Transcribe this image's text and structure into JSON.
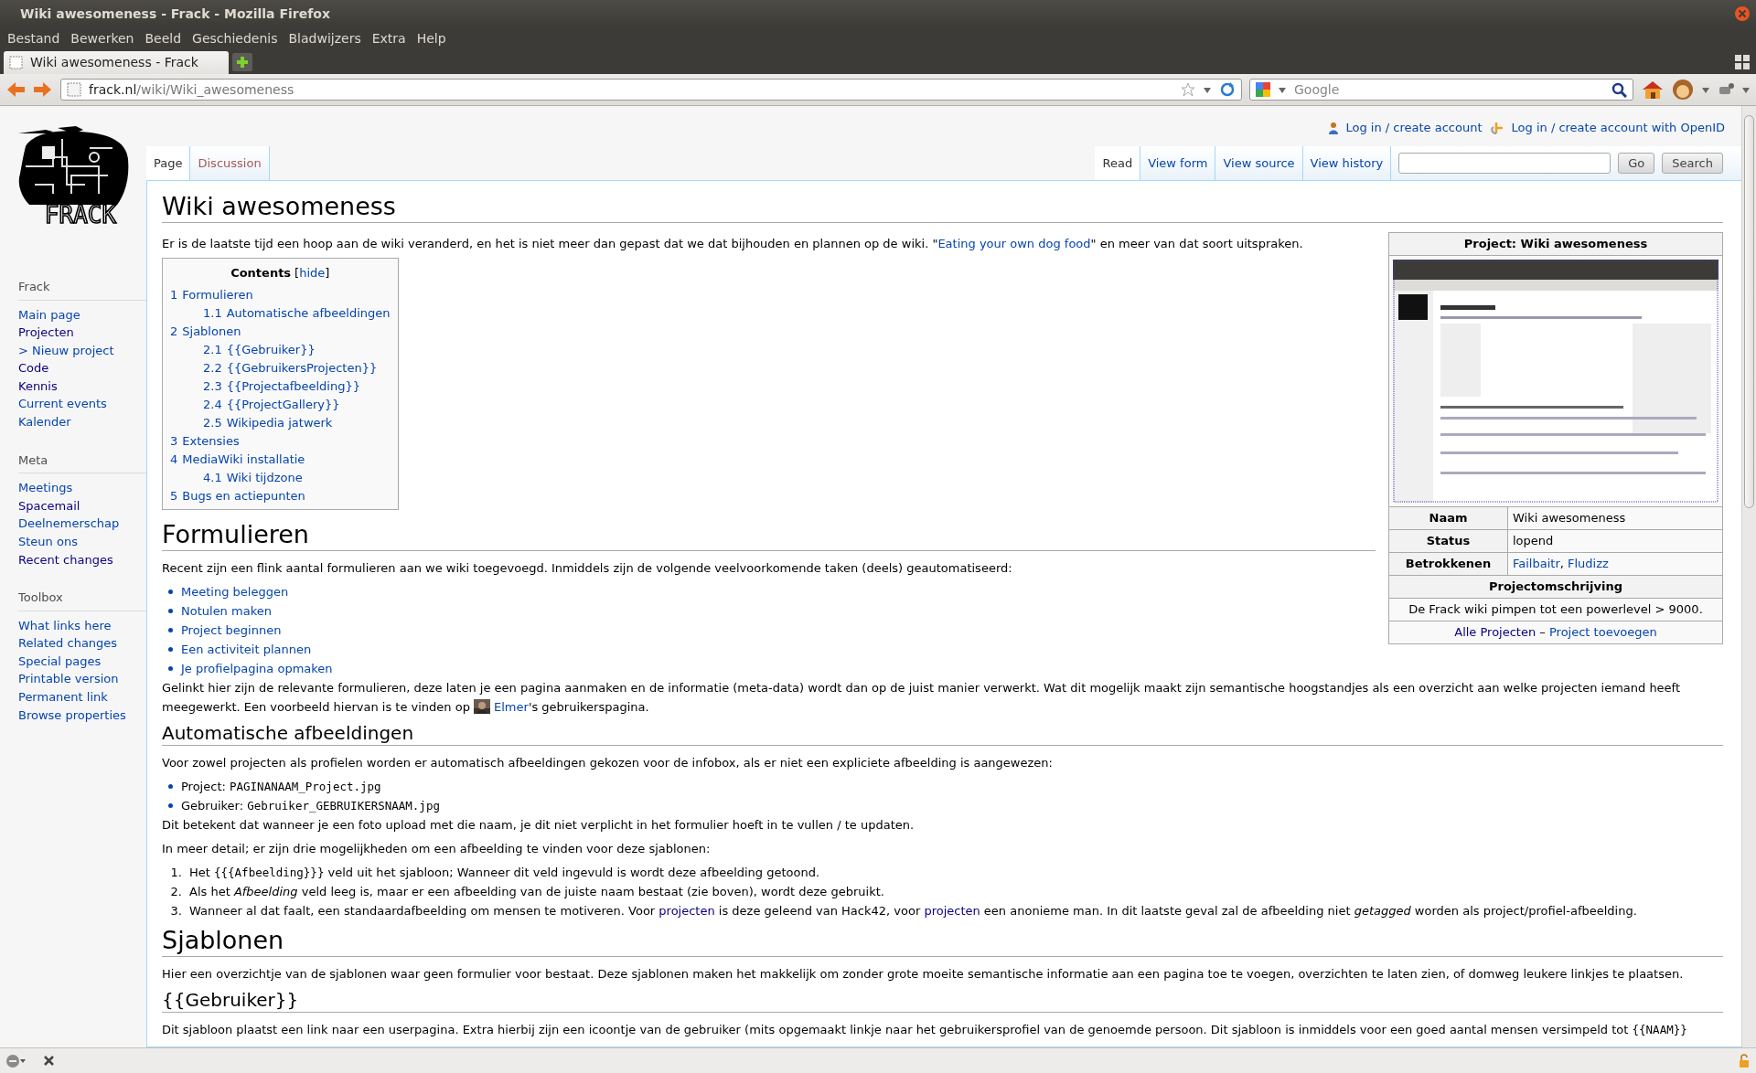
{
  "window": {
    "title": "Wiki awesomeness - Frack - Mozilla Firefox"
  },
  "menu": [
    "Bestand",
    "Bewerken",
    "Beeld",
    "Geschiedenis",
    "Bladwijzers",
    "Extra",
    "Help"
  ],
  "browser_tabs": [
    {
      "label": "Wiki awesomeness - Frack",
      "selected": true
    }
  ],
  "address_bar": {
    "domain": "frack.nl",
    "path": "/wiki/Wiki_awesomeness"
  },
  "web_search": {
    "placeholder": "Google"
  },
  "logo": {
    "text": "FRACK"
  },
  "personal_links": [
    "Log in / create account",
    "Log in / create account with OpenID"
  ],
  "page_tabs": [
    {
      "label": "Page",
      "selected": true,
      "exists": true
    },
    {
      "label": "Discussion",
      "selected": false,
      "exists": false
    }
  ],
  "view_tabs": [
    {
      "label": "Read",
      "selected": true
    },
    {
      "label": "View form",
      "selected": false
    },
    {
      "label": "View source",
      "selected": false
    },
    {
      "label": "View history",
      "selected": false
    }
  ],
  "wiki_search": {
    "buttons": [
      "Go",
      "Search"
    ]
  },
  "sidebar": [
    {
      "title": "Frack",
      "items": [
        {
          "label": "Main page",
          "visited": false
        },
        {
          "label": "Projecten",
          "visited": true
        },
        {
          "label": "> Nieuw project",
          "visited": false
        },
        {
          "label": "Code",
          "visited": true
        },
        {
          "label": "Kennis",
          "visited": true
        },
        {
          "label": "Current events",
          "visited": false
        },
        {
          "label": "Kalender",
          "visited": false
        }
      ]
    },
    {
      "title": "Meta",
      "items": [
        {
          "label": "Meetings",
          "visited": false
        },
        {
          "label": "Spacemail",
          "visited": true
        },
        {
          "label": "Deelnemerschap",
          "visited": false
        },
        {
          "label": "Steun ons",
          "visited": false
        },
        {
          "label": "Recent changes",
          "visited": true
        }
      ]
    },
    {
      "title": "Toolbox",
      "items": [
        {
          "label": "What links here",
          "visited": false
        },
        {
          "label": "Related changes",
          "visited": false
        },
        {
          "label": "Special pages",
          "visited": false
        },
        {
          "label": "Printable version",
          "visited": false
        },
        {
          "label": "Permanent link",
          "visited": false
        },
        {
          "label": "Browse properties",
          "visited": false
        }
      ]
    }
  ],
  "article": {
    "title": "Wiki awesomeness",
    "infobox": {
      "title": "Project: Wiki awesomeness",
      "image": {
        "kind": "picture"
      },
      "rows": [
        {
          "label": "Naam",
          "value": [
            {
              "kind": "text",
              "text": "Wiki awesomeness"
            }
          ]
        },
        {
          "label": "Status",
          "value": [
            {
              "kind": "text",
              "text": "lopend"
            }
          ]
        },
        {
          "label": "Betrokkenen",
          "value": [
            {
              "kind": "link",
              "text": "Failbaitr"
            },
            {
              "kind": "text",
              "text": ", "
            },
            {
              "kind": "link",
              "text": "Fludizz"
            }
          ]
        }
      ],
      "section_title": "Projectomschrijving",
      "description": "De Frack wiki pimpen tot een powerlevel > 9000.",
      "footer": [
        {
          "kind": "visited-link",
          "text": "Alle Projecten"
        },
        {
          "kind": "text",
          "text": " – "
        },
        {
          "kind": "link",
          "text": "Project toevoegen"
        }
      ]
    },
    "blocks": [
      {
        "kind": "paragraph",
        "segments": [
          {
            "kind": "text",
            "text": "Er is de laatste tijd een hoop aan de wiki veranderd, en het is niet meer dan gepast dat we dat bijhouden en plannen op de wiki. \""
          },
          {
            "kind": "link",
            "text": "Eating your own dog food"
          },
          {
            "kind": "text",
            "text": "\" en meer van dat soort uitspraken."
          }
        ]
      },
      {
        "kind": "toc",
        "title": "Contents",
        "toggle_open": "[",
        "toggle": "hide",
        "toggle_close": "]",
        "entries": [
          {
            "number": "1",
            "label": "Formulieren",
            "children": [
              {
                "number": "1.1",
                "label": "Automatische afbeeldingen"
              }
            ]
          },
          {
            "number": "2",
            "label": "Sjablonen",
            "children": [
              {
                "number": "2.1",
                "label": "{{Gebruiker}}"
              },
              {
                "number": "2.2",
                "label": "{{GebruikersProjecten}}"
              },
              {
                "number": "2.3",
                "label": "{{Projectafbeelding}}"
              },
              {
                "number": "2.4",
                "label": "{{ProjectGallery}}"
              },
              {
                "number": "2.5",
                "label": "Wikipedia jatwerk"
              }
            ]
          },
          {
            "number": "3",
            "label": "Extensies"
          },
          {
            "number": "4",
            "label": "MediaWiki installatie",
            "children": [
              {
                "number": "4.1",
                "label": "Wiki tijdzone"
              }
            ]
          },
          {
            "number": "5",
            "label": "Bugs en actiepunten"
          }
        ]
      },
      {
        "kind": "section_heading",
        "text": "Formulieren"
      },
      {
        "kind": "paragraph",
        "segments": [
          {
            "kind": "text",
            "text": "Recent zijn een flink aantal formulieren aan we wiki toegevoegd. Inmiddels zijn de volgende veelvoorkomende taken (deels) geautomatiseerd:"
          }
        ]
      },
      {
        "kind": "bullets",
        "items": [
          [
            {
              "kind": "link",
              "text": "Meeting beleggen"
            }
          ],
          [
            {
              "kind": "link",
              "text": "Notulen maken"
            }
          ],
          [
            {
              "kind": "link",
              "text": "Project beginnen"
            }
          ],
          [
            {
              "kind": "link",
              "text": "Een activiteit plannen"
            }
          ],
          [
            {
              "kind": "link",
              "text": "Je profielpagina opmaken"
            }
          ]
        ]
      },
      {
        "kind": "paragraph",
        "segments": [
          {
            "kind": "text",
            "text": "Gelinkt hier zijn de relevante formulieren, deze laten je een pagina aanmaken en de informatie (meta-data) wordt dan op de juist manier verwerkt. Wat dit mogelijk maakt zijn semantische hoogstandjes als een overzicht aan welke projecten iemand heeft meegewerkt. Een voorbeeld hiervan is te vinden op "
          },
          {
            "kind": "picture"
          },
          {
            "kind": "link",
            "text": "Elmer"
          },
          {
            "kind": "text",
            "text": "'s gebruikerspagina."
          }
        ]
      },
      {
        "kind": "subsection_heading",
        "text": "Automatische afbeeldingen"
      },
      {
        "kind": "paragraph",
        "segments": [
          {
            "kind": "text",
            "text": "Voor zowel projecten als profielen worden er automatisch afbeeldingen gekozen voor de infobox, als er niet een expliciete afbeelding is aangewezen:"
          }
        ]
      },
      {
        "kind": "bullets",
        "items": [
          [
            {
              "kind": "text",
              "text": "Project: "
            },
            {
              "kind": "code",
              "text": "PAGINANAAM_Project.jpg"
            }
          ],
          [
            {
              "kind": "text",
              "text": "Gebruiker: "
            },
            {
              "kind": "code",
              "text": "Gebruiker_GEBRUIKERSNAAM.jpg"
            }
          ]
        ]
      },
      {
        "kind": "paragraph",
        "segments": [
          {
            "kind": "text",
            "text": "Dit betekent dat wanneer je een foto upload met die naam, je dit niet verplicht in het formulier hoeft in te vullen / te updaten."
          }
        ]
      },
      {
        "kind": "paragraph",
        "segments": [
          {
            "kind": "text",
            "text": "In meer detail; er zijn drie mogelijkheden om een afbeelding te vinden voor deze sjablonen:"
          }
        ]
      },
      {
        "kind": "numbered",
        "items": [
          {
            "number": "1.",
            "segments": [
              {
                "kind": "text",
                "text": "Het "
              },
              {
                "kind": "code",
                "text": "{{{Afbeelding}}}"
              },
              {
                "kind": "text",
                "text": " veld uit het sjabloon; Wanneer dit veld ingevuld is wordt deze afbeelding getoond."
              }
            ]
          },
          {
            "number": "2.",
            "segments": [
              {
                "kind": "text",
                "text": "Als het *Afbeelding* veld leeg is, maar er een afbeelding van de juiste naam bestaat (zie boven), wordt deze gebruikt."
              }
            ]
          },
          {
            "number": "3.",
            "segments": [
              {
                "kind": "text",
                "text": "Wanneer al dat faalt, een standaardafbeelding om mensen te motiveren. Voor "
              },
              {
                "kind": "visited-link",
                "text": "projecten"
              },
              {
                "kind": "text",
                "text": " is deze geleend van Hack42, voor "
              },
              {
                "kind": "visited-link",
                "text": "projecten"
              },
              {
                "kind": "text",
                "text": " een anonieme man. In dit laatste geval zal de afbeelding niet *getagged* worden als project/profiel-afbeelding."
              }
            ]
          }
        ]
      },
      {
        "kind": "section_heading",
        "text": "Sjablonen"
      },
      {
        "kind": "paragraph",
        "segments": [
          {
            "kind": "text",
            "text": "Hier een overzichtje van de sjablonen waar geen formulier voor bestaat. Deze sjablonen maken het makkelijk om zonder grote moeite semantische informatie aan een pagina toe te voegen, overzichten te laten zien, of domweg leukere linkjes te plaatsen."
          }
        ]
      },
      {
        "kind": "subsection_heading",
        "text": "{{Gebruiker}}"
      },
      {
        "kind": "paragraph",
        "segments": [
          {
            "kind": "text",
            "text": "Dit sjabloon plaatst een link naar een userpagina. Extra hierbij zijn een icoontje van de gebruiker (mits opgemaakt linkje naar het gebruikersprofiel van de genoemde persoon. Dit sjabloon is inmiddels voor een goed aantal mensen versimpeld tot "
          },
          {
            "kind": "code",
            "text": "{{NAAM}}"
          }
        ]
      }
    ]
  }
}
